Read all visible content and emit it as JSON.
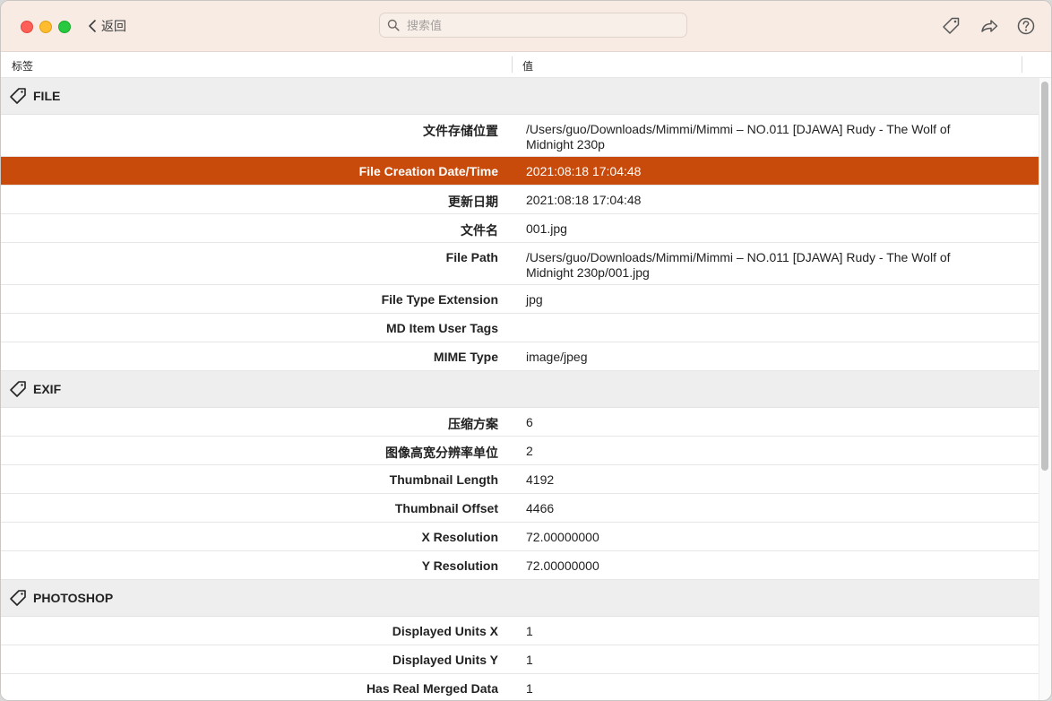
{
  "toolbar": {
    "back_label": "返回",
    "search_placeholder": "搜索值"
  },
  "columns": {
    "label": "标签",
    "value": "值"
  },
  "sections": [
    {
      "title": "FILE",
      "rows": [
        {
          "key": "文件存储位置",
          "value": "/Users/guo/Downloads/Mimmi/Mimmi – NO.011 [DJAWA] Rudy - The Wolf of Midnight 230p"
        },
        {
          "key": "File Creation Date/Time",
          "value": "2021:08:18 17:04:48",
          "selected": true
        },
        {
          "key": "更新日期",
          "value": "2021:08:18 17:04:48"
        },
        {
          "key": "文件名",
          "value": "001.jpg"
        },
        {
          "key": "File Path",
          "value": "/Users/guo/Downloads/Mimmi/Mimmi – NO.011 [DJAWA] Rudy - The Wolf of Midnight 230p/001.jpg"
        },
        {
          "key": "File Type Extension",
          "value": "jpg"
        },
        {
          "key": "MD Item User Tags",
          "value": ""
        },
        {
          "key": "MIME Type",
          "value": "image/jpeg"
        }
      ]
    },
    {
      "title": "EXIF",
      "rows": [
        {
          "key": "压缩方案",
          "value": "6"
        },
        {
          "key": "图像高宽分辨率单位",
          "value": "2"
        },
        {
          "key": "Thumbnail Length",
          "value": "4192"
        },
        {
          "key": "Thumbnail Offset",
          "value": "4466"
        },
        {
          "key": "X Resolution",
          "value": "72.00000000"
        },
        {
          "key": "Y Resolution",
          "value": "72.00000000"
        }
      ]
    },
    {
      "title": "PHOTOSHOP",
      "rows": [
        {
          "key": "Displayed Units X",
          "value": "1"
        },
        {
          "key": "Displayed Units Y",
          "value": "1"
        },
        {
          "key": "Has Real Merged Data",
          "value": "1"
        }
      ]
    }
  ],
  "colors": {
    "selection": "#c94b0c",
    "titlebar": "#f7ebe4"
  },
  "icons": [
    "back-chevron-icon",
    "search-icon",
    "tag-icon",
    "share-icon",
    "help-icon"
  ]
}
